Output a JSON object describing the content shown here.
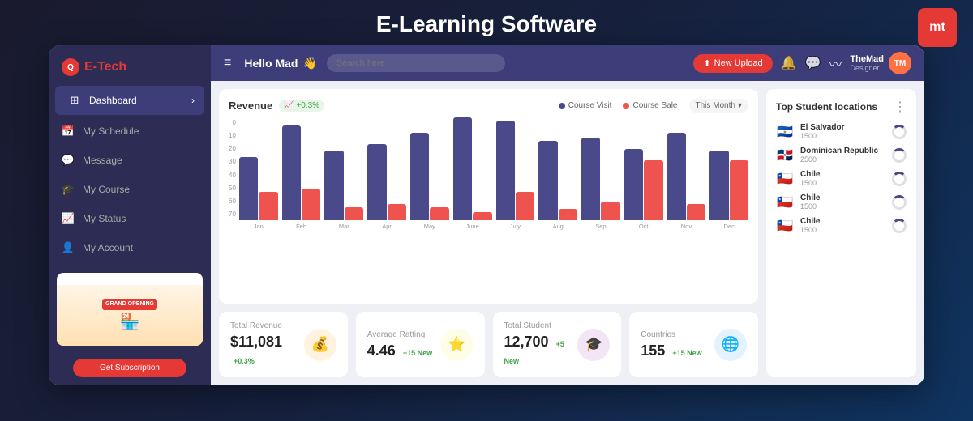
{
  "page": {
    "title": "E-Learning Software"
  },
  "mt_logo": "mt",
  "sidebar": {
    "logo": "E-Tech",
    "nav_items": [
      {
        "id": "dashboard",
        "label": "Dashboard",
        "icon": "⊞",
        "active": true
      },
      {
        "id": "schedule",
        "label": "My Schedule",
        "icon": "📅",
        "active": false
      },
      {
        "id": "message",
        "label": "Message",
        "icon": "💬",
        "active": false
      },
      {
        "id": "course",
        "label": "My Course",
        "icon": "🎓",
        "active": false
      },
      {
        "id": "status",
        "label": "My Status",
        "icon": "📈",
        "active": false
      },
      {
        "id": "account",
        "label": "My Account",
        "icon": "👤",
        "active": false
      }
    ],
    "ad_label": "GRAND\nOPENING",
    "subscribe_btn": "Get Subscription"
  },
  "topbar": {
    "hamburger": "≡",
    "greeting": "Hello Mad",
    "greeting_emoji": "👋",
    "search_placeholder": "Search here",
    "upload_btn": "New Upload",
    "upload_icon": "⬆",
    "bell_icon": "🔔",
    "chat_icon": "💬",
    "pulse_icon": "〰",
    "user_name": "TheMad",
    "user_role": "Designer"
  },
  "chart": {
    "title": "Revenue",
    "badge": "+0.3%",
    "badge_icon": "📈",
    "legend": [
      {
        "label": "Course Visit",
        "color": "#4a4a8a"
      },
      {
        "label": "Course Sale",
        "color": "#ef5350"
      }
    ],
    "filter": "This Month",
    "y_labels": [
      "0",
      "10",
      "20",
      "30",
      "40",
      "50",
      "60",
      "70"
    ],
    "months": [
      {
        "label": "Jan",
        "blue": 40,
        "red": 18
      },
      {
        "label": "Feb",
        "blue": 60,
        "red": 20
      },
      {
        "label": "Mar",
        "blue": 44,
        "red": 8
      },
      {
        "label": "Apr",
        "blue": 48,
        "red": 10
      },
      {
        "label": "May",
        "blue": 55,
        "red": 8
      },
      {
        "label": "June",
        "blue": 65,
        "red": 5
      },
      {
        "label": "July",
        "blue": 63,
        "red": 18
      },
      {
        "label": "Aug",
        "blue": 50,
        "red": 7
      },
      {
        "label": "Sep",
        "blue": 52,
        "red": 12
      },
      {
        "label": "Oct",
        "blue": 45,
        "red": 38
      },
      {
        "label": "Nov",
        "blue": 55,
        "red": 10
      },
      {
        "label": "Dec",
        "blue": 44,
        "red": 38
      }
    ]
  },
  "stats": [
    {
      "id": "revenue",
      "label": "Total Revenue",
      "value": "$11,081",
      "change": "+0.3%",
      "icon": "💰",
      "icon_class": "orange"
    },
    {
      "id": "rating",
      "label": "Average Ratting",
      "value": "4.46",
      "change": "+15 New",
      "icon": "⭐",
      "icon_class": "yellow"
    },
    {
      "id": "students",
      "label": "Total Student",
      "value": "12,700",
      "change": "+5 New",
      "icon": "🎓",
      "icon_class": "purple"
    },
    {
      "id": "countries",
      "label": "Countries",
      "value": "155",
      "change": "+15 New",
      "icon": "🌐",
      "icon_class": "blue"
    }
  ],
  "locations": {
    "title": "Top Student locations",
    "more_icon": "⋮",
    "items": [
      {
        "country": "El Salvador",
        "count": "1500",
        "flag": "🇸🇻"
      },
      {
        "country": "Dominican Republic",
        "count": "2500",
        "flag": "🇩🇴"
      },
      {
        "country": "Chile",
        "count": "1500",
        "flag": "🇨🇱"
      },
      {
        "country": "Chile",
        "count": "1500",
        "flag": "🇨🇱"
      },
      {
        "country": "Chile",
        "count": "1500",
        "flag": "🇨🇱"
      }
    ]
  }
}
